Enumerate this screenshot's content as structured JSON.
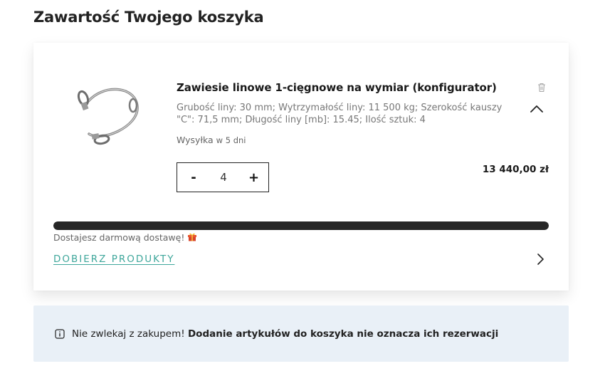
{
  "page": {
    "title": "Zawartość Twojego koszyka"
  },
  "cart": {
    "item": {
      "name": "Zawiesie linowe 1-cięgnowe na wymiar (konfigurator)",
      "params": "Grubość liny: 30 mm; Wytrzymałość liny: 11 500 kg; Szerokość kauszy \"C\": 71,5 mm; Długość liny [mb]: 15.45; Ilość sztuk: 4",
      "shipping_label": "Wysyłka",
      "shipping_days": "w 5 dni",
      "quantity": "4",
      "minus_label": "-",
      "plus_label": "+",
      "price": "13 440,00 zł",
      "icons": {
        "delete": "trash-icon",
        "collapse": "chevron-up-icon"
      }
    },
    "free_shipping": {
      "progress_percent": 100,
      "message": "Dostajesz darmową dostawę!",
      "icon": "gift-icon"
    },
    "add_products_label": "DOBIERZ PRODUKTY",
    "add_products_icon": "chevron-right-icon"
  },
  "notice": {
    "icon": "info-icon",
    "text": "Nie zwlekaj z zakupem!",
    "strong": "Dodanie artykułów do koszyka nie oznacza ich rezerwacji"
  },
  "colors": {
    "accent": "#3fa79b",
    "progress": "#262626",
    "info_bg": "#e9f0f7"
  }
}
